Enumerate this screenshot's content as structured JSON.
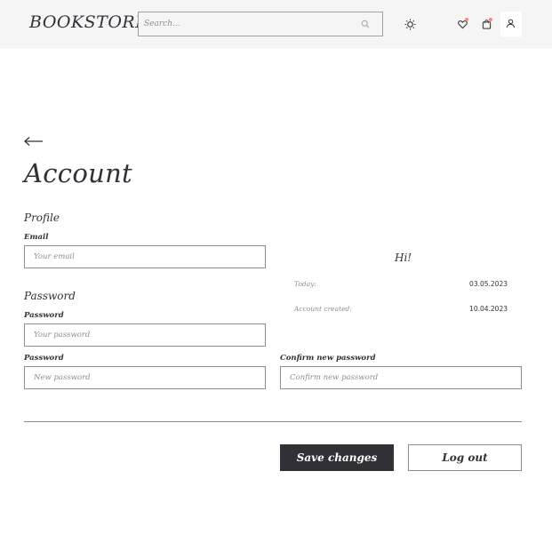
{
  "header": {
    "logo": "BOOKSTORE",
    "search_placeholder": "Search...",
    "icons": [
      "search-icon",
      "sun-icon",
      "heart-icon",
      "cart-icon",
      "user-icon"
    ],
    "badge_color": "#fc857f"
  },
  "page": {
    "back_icon": "arrow-left-icon",
    "title": "Account"
  },
  "profile": {
    "section_title": "Profile",
    "email_label": "Email",
    "email_placeholder": "Your email"
  },
  "password": {
    "section_title": "Password",
    "current_label": "Password",
    "current_placeholder": "Your password",
    "new_label": "Password",
    "new_placeholder": "New password",
    "confirm_label": "Confirm new password",
    "confirm_placeholder": "Confirm new password"
  },
  "info": {
    "greeting": "Hi!",
    "today_label": "Today:",
    "today_value": "03.05.2023",
    "created_label": "Account created:",
    "created_value": "10.04.2023"
  },
  "actions": {
    "save_label": "Save changes",
    "logout_label": "Log out"
  },
  "colors": {
    "primary": "#313037",
    "header_bg": "#f5f5f5",
    "border": "#8d8d8d"
  }
}
